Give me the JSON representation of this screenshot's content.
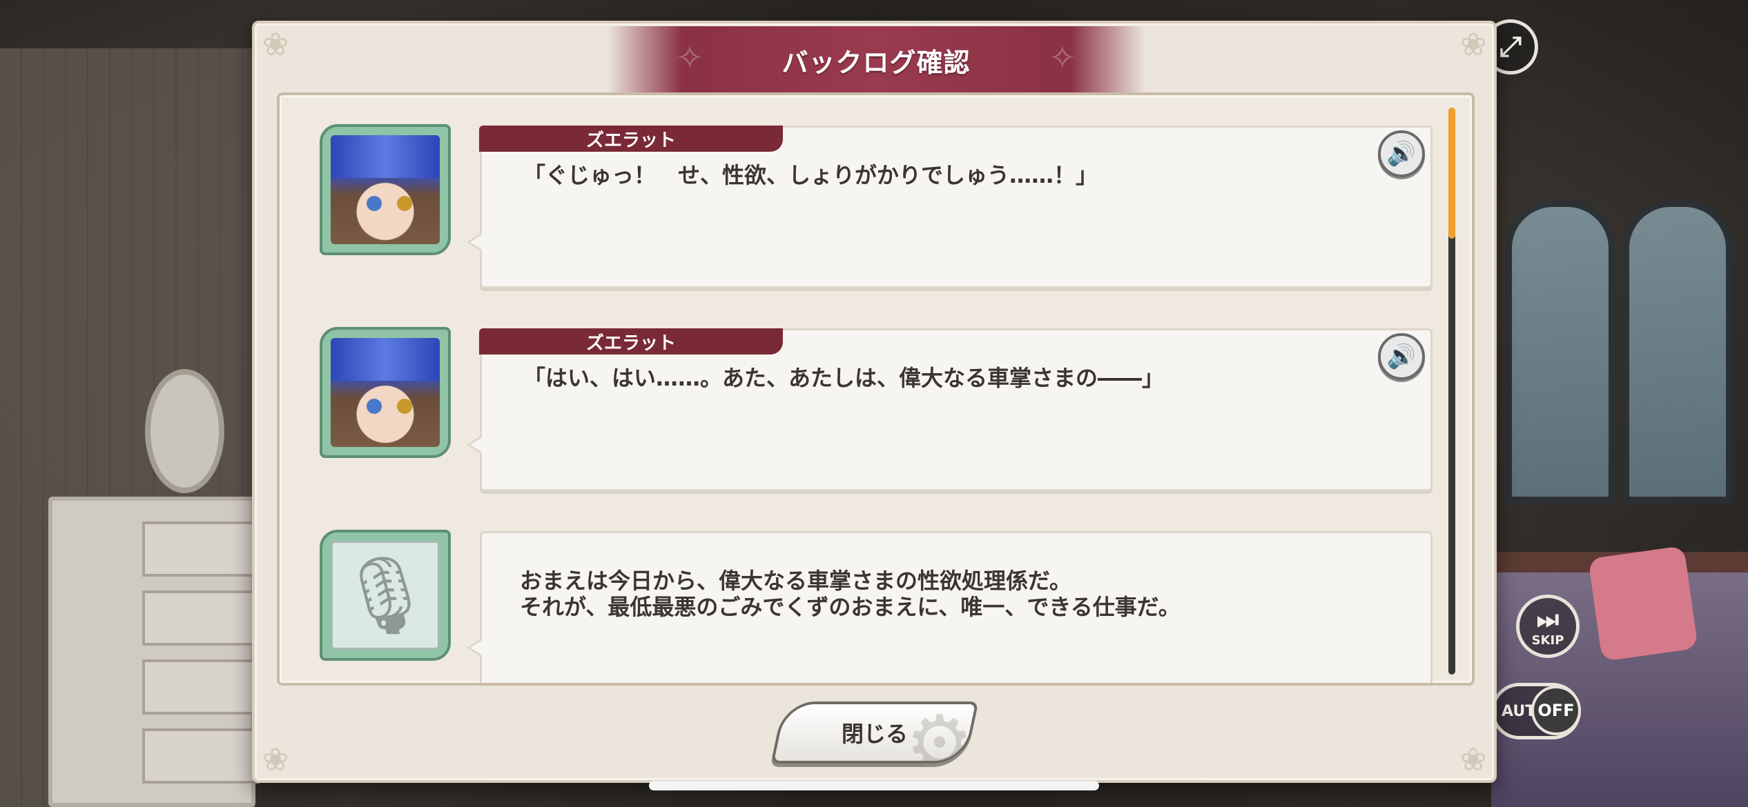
{
  "dialog": {
    "title": "バックログ確認",
    "close_label": "閉じる"
  },
  "hud": {
    "skip_label": "SKIP",
    "auto_label": "AUTO",
    "auto_state": "OFF"
  },
  "entries": [
    {
      "speaker": "ズエラット",
      "text": "「ぐじゅっ！　せ、性欲、しょりがかりでしゅう……！」",
      "has_voice": true,
      "portrait": "character-portrait"
    },
    {
      "speaker": "ズエラット",
      "text": "「はい、はい……。あた、あたしは、偉大なる車掌さまの――」",
      "has_voice": true,
      "portrait": "character-portrait"
    },
    {
      "speaker": "",
      "text": "おまえは今日から、偉大なる車掌さまの性欲処理係だ。\nそれが、最低最悪のごみでくずのおまえに、唯一、できる仕事だ。",
      "has_voice": false,
      "portrait": "microphone-icon"
    }
  ],
  "icons": {
    "voice": "speaker-icon",
    "narration": "microphone-icon",
    "expand": "expand-icon",
    "skip": "skip-icon"
  },
  "colors": {
    "title_bar": "#9a3a4f",
    "name_tag": "#7a2a36",
    "scroll_thumb": "#f0a030",
    "portrait_frame": "#8fc4a6"
  }
}
